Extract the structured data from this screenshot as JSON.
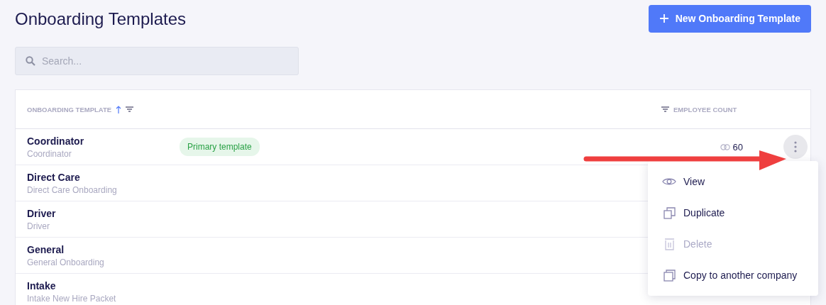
{
  "page": {
    "title": "Onboarding Templates",
    "new_button": "New Onboarding Template"
  },
  "search": {
    "placeholder": "Search..."
  },
  "table": {
    "columns": [
      {
        "label": "ONBOARDING TEMPLATE",
        "sorted": true
      },
      {
        "label": "EMPLOYEE COUNT",
        "sorted": false
      }
    ],
    "rows": [
      {
        "name": "Coordinator",
        "description": "Coordinator",
        "primary": true,
        "badge": "Primary template",
        "count": "60"
      },
      {
        "name": "Direct Care",
        "description": "Direct Care Onboarding",
        "primary": false
      },
      {
        "name": "Driver",
        "description": "Driver",
        "primary": false
      },
      {
        "name": "General",
        "description": "General Onboarding",
        "primary": false
      },
      {
        "name": "Intake",
        "description": "Intake New Hire Packet",
        "primary": false
      }
    ]
  },
  "menu": {
    "items": [
      {
        "kind": "view",
        "label": "View",
        "disabled": false
      },
      {
        "kind": "duplicate",
        "label": "Duplicate",
        "disabled": false
      },
      {
        "kind": "delete",
        "label": "Delete",
        "disabled": true
      },
      {
        "kind": "copy",
        "label": "Copy to another company",
        "disabled": false
      }
    ]
  }
}
